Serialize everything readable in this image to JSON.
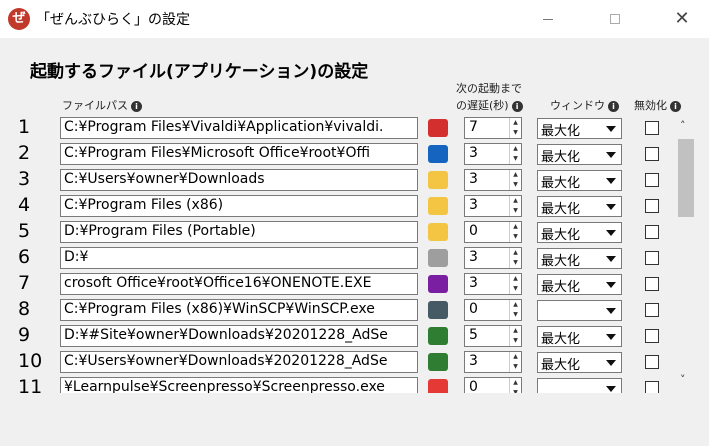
{
  "window": {
    "app_icon": "ぜ",
    "title": "「ぜんぶひらく」の設定",
    "close_glyph": "✕"
  },
  "section_title": "起動するファイル(アプリケーション)の設定",
  "headers": {
    "filepath": "ファイルパス",
    "delay_line1": "次の起動まで",
    "delay_line2": "の遅延(秒)",
    "window": "ウィンドウ",
    "disable": "無効化",
    "info_glyph": "i"
  },
  "rows": [
    {
      "num": "1",
      "path": "C:¥Program Files¥Vivaldi¥Application¥vivaldi.",
      "icon": "vivaldi-icon",
      "icon_color": "#d32f2f",
      "delay": "7",
      "window": "最大化"
    },
    {
      "num": "2",
      "path": "C:¥Program Files¥Microsoft Office¥root¥Offi",
      "icon": "outlook-icon",
      "icon_color": "#1565c0",
      "delay": "3",
      "window": "最大化"
    },
    {
      "num": "3",
      "path": "C:¥Users¥owner¥Downloads",
      "icon": "downloads-folder-icon",
      "icon_color": "#f4c542",
      "delay": "3",
      "window": "最大化"
    },
    {
      "num": "4",
      "path": "C:¥Program Files (x86)",
      "icon": "folder-icon",
      "icon_color": "#f4c542",
      "delay": "3",
      "window": "最大化"
    },
    {
      "num": "5",
      "path": "D:¥Program Files (Portable)",
      "icon": "folder-icon",
      "icon_color": "#f4c542",
      "delay": "0",
      "window": "最大化"
    },
    {
      "num": "6",
      "path": "D:¥",
      "icon": "drive-icon",
      "icon_color": "#9e9e9e",
      "delay": "3",
      "window": "最大化"
    },
    {
      "num": "7",
      "path": "crosoft Office¥root¥Office16¥ONENOTE.EXE",
      "icon": "onenote-icon",
      "icon_color": "#7b1fa2",
      "delay": "3",
      "window": "最大化"
    },
    {
      "num": "8",
      "path": "C:¥Program Files (x86)¥WinSCP¥WinSCP.exe",
      "icon": "winscp-icon",
      "icon_color": "#455a64",
      "delay": "0",
      "window": ""
    },
    {
      "num": "9",
      "path": "D:¥#Site¥owner¥Downloads¥20201228_AdSe",
      "icon": "excel-icon",
      "icon_color": "#2e7d32",
      "delay": "5",
      "window": "最大化"
    },
    {
      "num": "10",
      "path": "C:¥Users¥owner¥Downloads¥20201228_AdSe",
      "icon": "excel-icon",
      "icon_color": "#2e7d32",
      "delay": "3",
      "window": "最大化"
    },
    {
      "num": "11",
      "path": "¥Learnpulse¥Screenpresso¥Screenpresso.exe",
      "icon": "screenpresso-icon",
      "icon_color": "#e53935",
      "delay": "0",
      "window": ""
    }
  ],
  "scrollbar": {
    "up": "˄",
    "down": "˅"
  }
}
